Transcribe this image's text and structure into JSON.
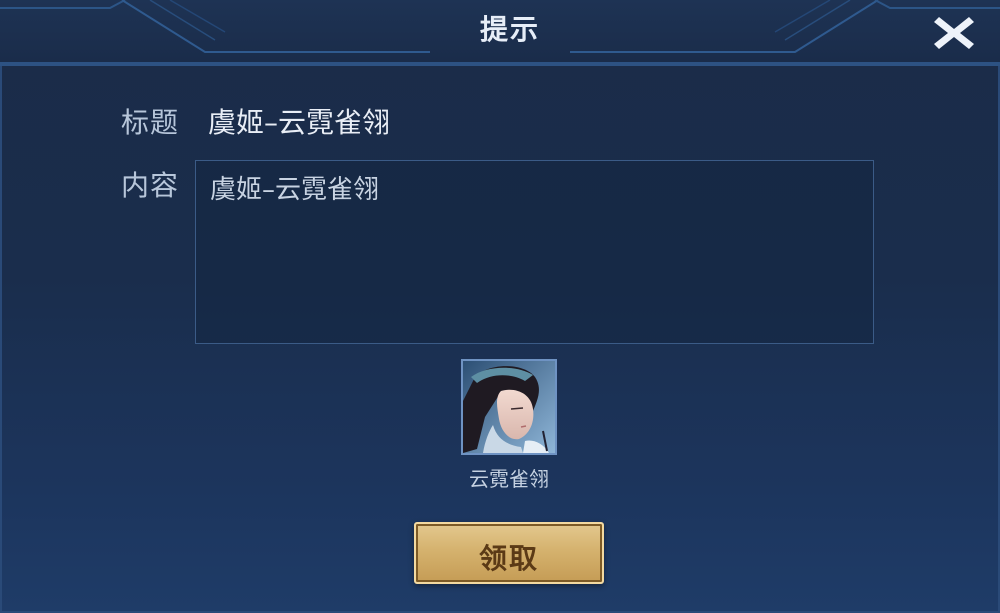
{
  "dialog": {
    "title": "提示",
    "close_icon": "close-icon"
  },
  "mail": {
    "title_label": "标题",
    "title_value": "虞姬–云霓雀翎",
    "content_label": "内容",
    "content_value": "虞姬–云霓雀翎"
  },
  "reward": {
    "name": "云霓雀翎",
    "icon": "skin-portrait"
  },
  "actions": {
    "claim_label": "领取"
  },
  "colors": {
    "background": "#1b2c48",
    "border": "#2d5283",
    "button_gold": "#d5b26e",
    "button_text": "#5b3a16"
  }
}
